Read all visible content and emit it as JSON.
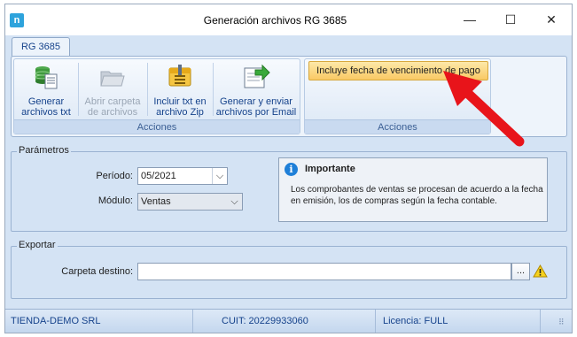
{
  "window": {
    "title": "Generación archivos RG 3685",
    "app_icon": "n",
    "controls": {
      "minimize": "—",
      "maximize": "☐",
      "close": "✕"
    }
  },
  "ribbon": {
    "tab": "RG 3685",
    "groups": [
      {
        "caption": "Acciones",
        "buttons": [
          {
            "line1": "Generar",
            "line2": "archivos txt",
            "icon": "database-file-icon",
            "enabled": true
          },
          {
            "line1": "Abrir carpeta",
            "line2": "de archivos",
            "icon": "open-folder-icon",
            "enabled": false
          },
          {
            "line1": "Incluir txt en",
            "line2": "archivo Zip",
            "icon": "zip-archive-icon",
            "enabled": true
          },
          {
            "line1": "Generar y enviar",
            "line2": "archivos por Email",
            "icon": "send-email-icon",
            "enabled": true
          }
        ]
      },
      {
        "caption": "Acciones",
        "toggle": "Incluye fecha de vencimiento de pago"
      }
    ]
  },
  "parametros": {
    "legend": "Parámetros",
    "periodo_label": "Período:",
    "periodo_value": "05/2021",
    "modulo_label": "Módulo:",
    "modulo_value": "Ventas",
    "info_title": "Importante",
    "info_text": "Los comprobantes de ventas se procesan de acuerdo a la fecha en emisión, los de compras según la fecha contable."
  },
  "exportar": {
    "legend": "Exportar",
    "carpeta_label": "Carpeta destino:",
    "carpeta_value": "",
    "browse_label": "...",
    "warning_icon": "warning-icon"
  },
  "status": {
    "company": "TIENDA-DEMO SRL",
    "cuit": "CUIT: 20229933060",
    "licencia": "Licencia: FULL"
  },
  "colors": {
    "annotation_arrow": "#e8141a",
    "toggle_highlight": "#f9c964"
  }
}
